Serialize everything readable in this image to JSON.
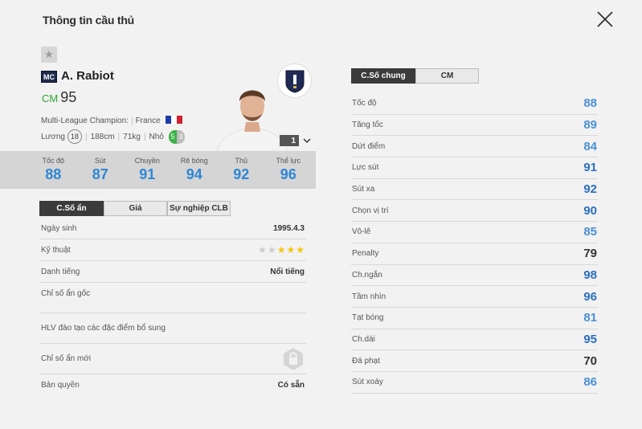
{
  "header": {
    "title": "Thông tin cầu thủ"
  },
  "player": {
    "position_badge": "MC",
    "name": "A. Rabiot",
    "position": "CM",
    "ovr": "95",
    "club": "Multi-League Champion:",
    "nation": "France",
    "wage_label": "Lương",
    "wage": "18",
    "height": "188cm",
    "weight": "71kg",
    "body_type": "Nhỏ",
    "skill_left": "5",
    "skill_right": "3",
    "level": "1",
    "flag_colors": [
      "#1e3aa8",
      "#ffffff",
      "#d0202e"
    ]
  },
  "main_stats": [
    {
      "label": "Tốc độ",
      "value": "88"
    },
    {
      "label": "Sút",
      "value": "87"
    },
    {
      "label": "Chuyền",
      "value": "91"
    },
    {
      "label": "Rê bóng",
      "value": "94"
    },
    {
      "label": "Thủ",
      "value": "92"
    },
    {
      "label": "Thể lực",
      "value": "96"
    }
  ],
  "left_tabs": [
    "C.Số ẩn",
    "Giá",
    "Sự nghiệp CLB"
  ],
  "details": {
    "birth_label": "Ngày sinh",
    "birth": "1995.4.3",
    "skill_label": "Kỹ thuật",
    "skill_stars": 3,
    "skill_max": 5,
    "fame_label": "Danh tiếng",
    "fame": "Nổi tiếng",
    "hidden_label": "Chỉ số ẩn gốc",
    "coach_label": "HLV đào tạo các đặc điểm bổ sung",
    "new_hidden_label": "Chỉ số ẩn mới",
    "copyright_label": "Bản quyền",
    "copyright": "Có sẵn"
  },
  "right_tabs": [
    "C.Số chung",
    "CM"
  ],
  "attributes": [
    {
      "label": "Tốc độ",
      "value": "88",
      "color": "#4a90d6"
    },
    {
      "label": "Tăng tốc",
      "value": "89",
      "color": "#4a90d6"
    },
    {
      "label": "Dứt điểm",
      "value": "84",
      "color": "#4a90d6"
    },
    {
      "label": "Lực sút",
      "value": "91",
      "color": "#2a6fc0"
    },
    {
      "label": "Sút xa",
      "value": "92",
      "color": "#2a6fc0"
    },
    {
      "label": "Chọn vị trí",
      "value": "90",
      "color": "#2a6fc0"
    },
    {
      "label": "Vô-lê",
      "value": "85",
      "color": "#4a90d6"
    },
    {
      "label": "Penalty",
      "value": "79",
      "color": "#333333"
    },
    {
      "label": "Ch.ngắn",
      "value": "98",
      "color": "#2a6fc0"
    },
    {
      "label": "Tầm nhìn",
      "value": "96",
      "color": "#2a6fc0"
    },
    {
      "label": "Tạt bóng",
      "value": "81",
      "color": "#4a90d6"
    },
    {
      "label": "Ch.dài",
      "value": "95",
      "color": "#2a6fc0"
    },
    {
      "label": "Đá phạt",
      "value": "70",
      "color": "#333333"
    },
    {
      "label": "Sút xoáy",
      "value": "86",
      "color": "#4a90d6"
    }
  ]
}
